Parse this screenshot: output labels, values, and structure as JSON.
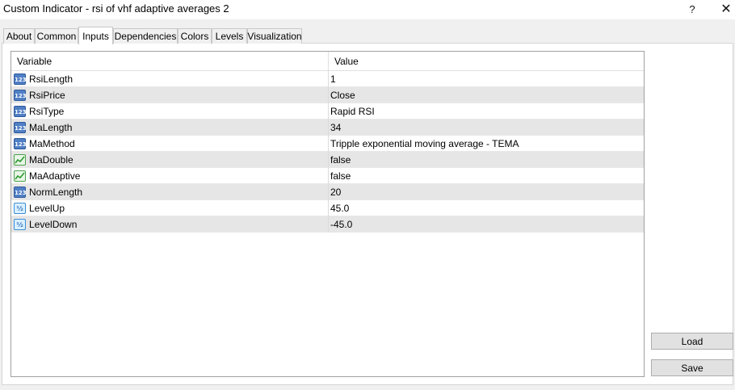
{
  "window": {
    "title": "Custom Indicator - rsi of vhf adaptive averages 2",
    "help_label": "?",
    "close_label": "✕"
  },
  "tabs": [
    {
      "label": "About",
      "active": false
    },
    {
      "label": "Common",
      "active": false
    },
    {
      "label": "Inputs",
      "active": true
    },
    {
      "label": "Dependencies",
      "active": false
    },
    {
      "label": "Colors",
      "active": false
    },
    {
      "label": "Levels",
      "active": false
    },
    {
      "label": "Visualization",
      "active": false
    }
  ],
  "grid": {
    "columns": {
      "variable": "Variable",
      "value": "Value"
    },
    "rows": [
      {
        "icon": "integer-icon",
        "name": "RsiLength",
        "value": "1"
      },
      {
        "icon": "integer-icon",
        "name": "RsiPrice",
        "value": "Close"
      },
      {
        "icon": "integer-icon",
        "name": "RsiType",
        "value": "Rapid RSI"
      },
      {
        "icon": "integer-icon",
        "name": "MaLength",
        "value": "34"
      },
      {
        "icon": "integer-icon",
        "name": "MaMethod",
        "value": "Tripple exponential moving average - TEMA"
      },
      {
        "icon": "boolean-icon",
        "name": "MaDouble",
        "value": "false"
      },
      {
        "icon": "boolean-icon",
        "name": "MaAdaptive",
        "value": "false"
      },
      {
        "icon": "integer-icon",
        "name": "NormLength",
        "value": "20"
      },
      {
        "icon": "double-icon",
        "name": "LevelUp",
        "value": "45.0"
      },
      {
        "icon": "double-icon",
        "name": "LevelDown",
        "value": "-45.0"
      }
    ]
  },
  "buttons": {
    "load": "Load",
    "save": "Save"
  }
}
